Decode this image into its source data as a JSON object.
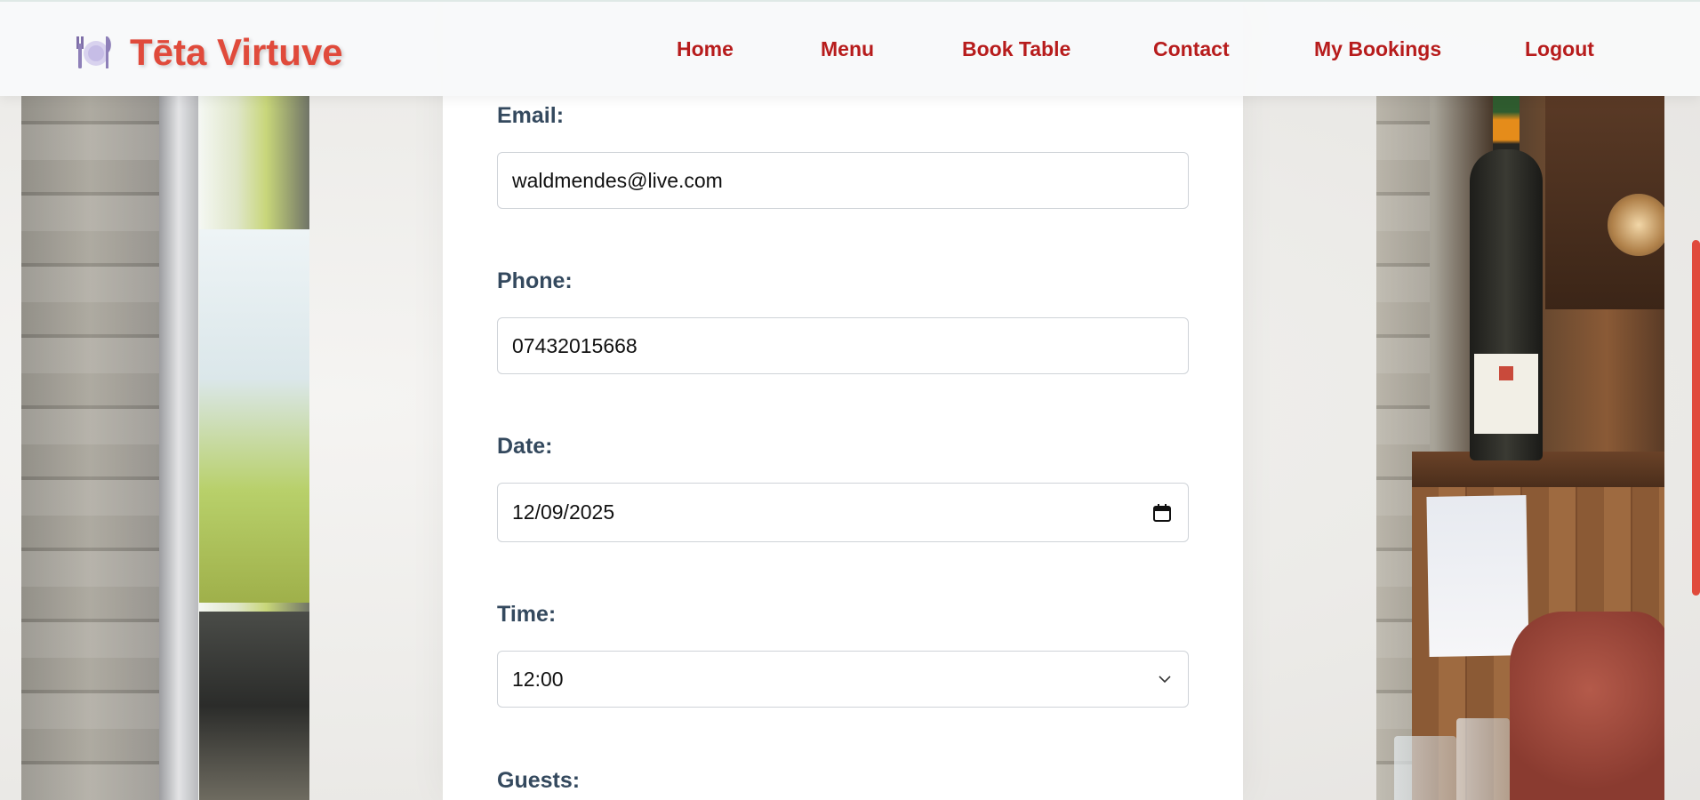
{
  "brand": {
    "title": "Tēta Virtuve",
    "icon": "plate-cutlery-icon"
  },
  "nav": {
    "items": [
      {
        "label": "Home"
      },
      {
        "label": "Menu"
      },
      {
        "label": "Book Table"
      },
      {
        "label": "Contact"
      },
      {
        "label": "My Bookings"
      },
      {
        "label": "Logout"
      }
    ]
  },
  "form": {
    "email": {
      "label": "Email:",
      "value": "waldmendes@live.com"
    },
    "phone": {
      "label": "Phone:",
      "value": "07432015668"
    },
    "date": {
      "label": "Date:",
      "value": "12/09/2025",
      "icon": "calendar-icon"
    },
    "time": {
      "label": "Time:",
      "value": "12:00",
      "icon": "chevron-down-icon"
    },
    "guests": {
      "label": "Guests:"
    }
  },
  "colors": {
    "brand": "#e04a3b",
    "nav_link": "#b71c1c",
    "label": "#34495e",
    "scrollbar": "#e04a3b"
  }
}
